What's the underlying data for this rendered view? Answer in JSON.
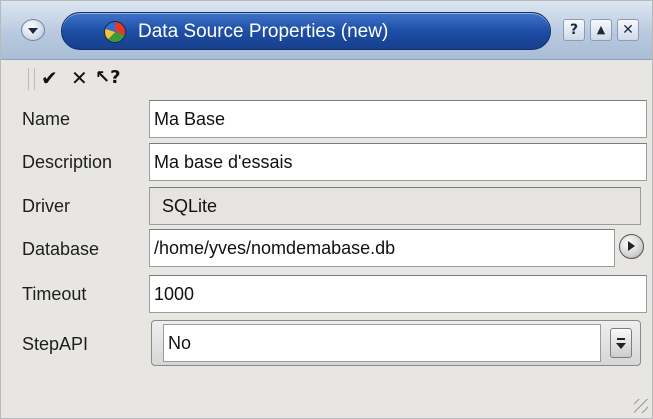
{
  "window": {
    "title": "Data Source Properties (new)",
    "title_buttons": {
      "help": "?",
      "shade": "▲",
      "close": "✕"
    }
  },
  "toolbar": {
    "ok_icon": "✔",
    "cancel_icon": "✕",
    "whats_this_icon": "↖?"
  },
  "form": {
    "name": {
      "label": "Name",
      "value": "Ma Base"
    },
    "description": {
      "label": "Description",
      "value": "Ma base d'essais"
    },
    "driver": {
      "label": "Driver",
      "value": "SQLite"
    },
    "database": {
      "label": "Database",
      "value": "/home/yves/nomdemabase.db"
    },
    "timeout": {
      "label": "Timeout",
      "value": "1000"
    },
    "stepapi": {
      "label": "StepAPI",
      "value": "No"
    }
  },
  "colors": {
    "title_pill": "#1e4ea6",
    "title_bar": "#b9cadf",
    "window_bg": "#e7e6e3"
  }
}
